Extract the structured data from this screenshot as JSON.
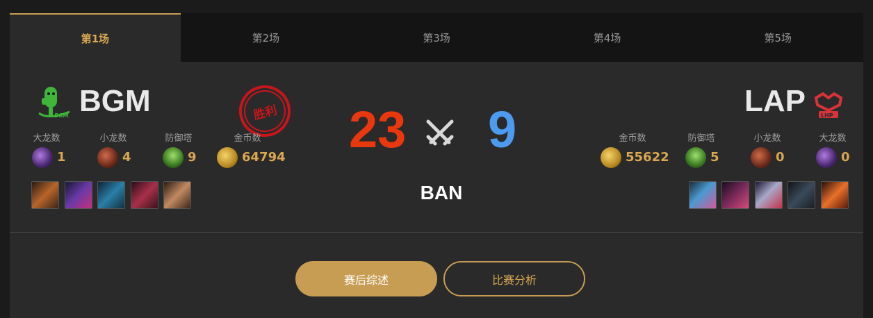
{
  "tabs": [
    {
      "label": "第1场",
      "active": true
    },
    {
      "label": "第2场",
      "active": false
    },
    {
      "label": "第3场",
      "active": false
    },
    {
      "label": "第4场",
      "active": false
    },
    {
      "label": "第5场",
      "active": false
    }
  ],
  "left_team": {
    "name": "BGM",
    "logo_icon": "bgm-green-logo-icon",
    "winner_stamp": "胜利",
    "stats": [
      {
        "label": "大龙数",
        "value": "1",
        "icon": "baron-icon"
      },
      {
        "label": "小龙数",
        "value": "4",
        "icon": "dragon-icon"
      },
      {
        "label": "防御塔",
        "value": "9",
        "icon": "tower-icon"
      },
      {
        "label": "金币数",
        "value": "64794",
        "icon": "gold-icon"
      }
    ]
  },
  "right_team": {
    "name": "LAP",
    "logo_icon": "lap-red-logo-icon",
    "stats": [
      {
        "label": "金币数",
        "value": "55622",
        "icon": "gold-icon"
      },
      {
        "label": "防御塔",
        "value": "5",
        "icon": "tower-icon"
      },
      {
        "label": "小龙数",
        "value": "0",
        "icon": "dragon-icon"
      },
      {
        "label": "大龙数",
        "value": "0",
        "icon": "baron-icon"
      }
    ]
  },
  "score": {
    "left": "23",
    "right": "9",
    "left_color": "#e9380d",
    "right_color": "#4c9bee"
  },
  "ban_title": "BAN",
  "buttons": {
    "summary": "赛后综述",
    "analysis": "比赛分析"
  },
  "colors": {
    "accent": "#c79d53",
    "win_red": "#c8151b",
    "bgm_green": "#3fb53a",
    "lap_red": "#d8333a"
  }
}
